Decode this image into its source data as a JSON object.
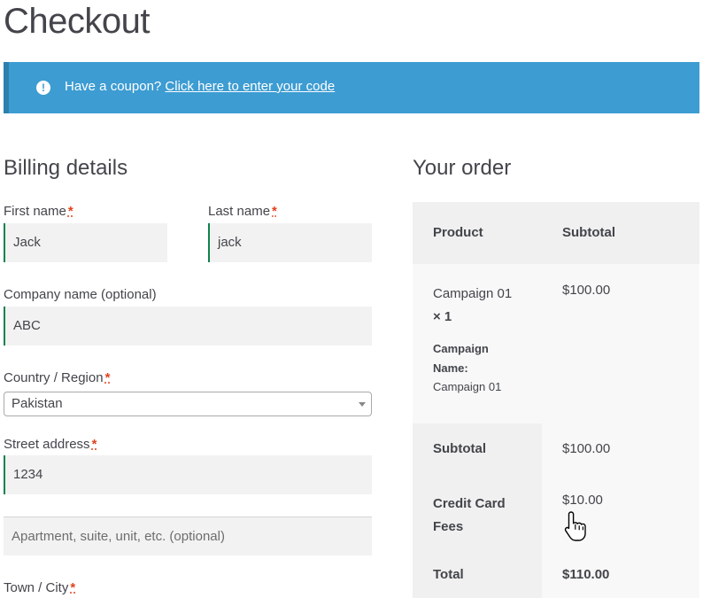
{
  "page": {
    "title": "Checkout"
  },
  "notice": {
    "text": "Have a coupon?",
    "link": "Click here to enter your code",
    "icon": "exclamation-circle-icon",
    "color": "#3d9cd2"
  },
  "billing": {
    "heading": "Billing details",
    "required_mark": "*",
    "first_name": {
      "label": "First name",
      "value": "Jack"
    },
    "last_name": {
      "label": "Last name",
      "value": "jack"
    },
    "company": {
      "label": "Company name (optional)",
      "value": "ABC"
    },
    "country": {
      "label": "Country / Region",
      "value": "Pakistan"
    },
    "street": {
      "label": "Street address",
      "value": "1234",
      "line2_placeholder": "Apartment, suite, unit, etc. (optional)"
    },
    "city": {
      "label": "Town / City"
    }
  },
  "order": {
    "heading": "Your order",
    "col_product": "Product",
    "col_subtotal": "Subtotal",
    "item": {
      "name": "Campaign 01",
      "qty": "× 1",
      "meta_label": "Campaign Name:",
      "meta_value": "Campaign 01",
      "price": "$100.00"
    },
    "subtotal": {
      "label": "Subtotal",
      "value": "$100.00"
    },
    "fee": {
      "label": "Credit Card Fees",
      "value": "$10.00"
    },
    "total": {
      "label": "Total",
      "value": "$110.00"
    }
  }
}
